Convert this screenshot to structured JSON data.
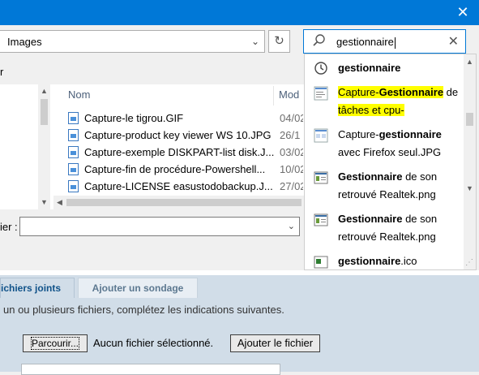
{
  "dialog": {
    "close_glyph": "✕",
    "location": "Images",
    "refresh_glyph": "↻",
    "search_value": "gestionnaire",
    "clear_glyph": "✕",
    "toolbar_fragment": "r",
    "column_name": "Nom",
    "column_modified": "Mod",
    "files": [
      {
        "name": "Capture-le tigrou.GIF",
        "date": "04/02"
      },
      {
        "name": "Capture-product key viewer WS 10.JPG",
        "date": "26/1"
      },
      {
        "name": "Capture-exemple DISKPART-list disk.J...",
        "date": "03/02"
      },
      {
        "name": "Capture-fin de procédure-Powershell...",
        "date": "10/02"
      },
      {
        "name": "Capture-LICENSE easustodobackup.J...",
        "date": "27/02"
      }
    ],
    "filename_label": "ier :",
    "suggestions": {
      "history": {
        "text": "gestionnaire",
        "icon": "history-icon"
      },
      "s1": {
        "pre": "Capture-",
        "bold": "Gestionnaire",
        "post": " de",
        "line2": "tâches et cpu-",
        "icon": "image-file-icon"
      },
      "s2": {
        "pre": "Capture-",
        "bold": "gestionnaire",
        "post": "",
        "line2": "avec Firefox seul.JPG",
        "icon": "image-file-icon"
      },
      "s3": {
        "bold": "Gestionnaire",
        "post": " de son",
        "line2": "retrouvé Realtek.png",
        "icon": "image-file-icon"
      },
      "s4": {
        "bold": "Gestionnaire",
        "post": " de son",
        "line2": "retrouvé Realtek.png",
        "icon": "image-file-icon"
      },
      "s5": {
        "bold": "gestionnaire",
        "post": ".ico",
        "icon": "image-file-icon"
      }
    }
  },
  "forum": {
    "tab_attachments": "ichiers joints",
    "tab_poll": "Ajouter un sondage",
    "instructions": "un ou plusieurs fichiers, complétez les indications suivantes.",
    "browse_button": "Parcourir...",
    "no_file": "Aucun fichier sélectionné.",
    "add_file_button": "Ajouter le fichier"
  },
  "colors": {
    "titlebar": "#0078d7",
    "highlight": "#ffff00",
    "forum_panel": "#d1dde8"
  }
}
